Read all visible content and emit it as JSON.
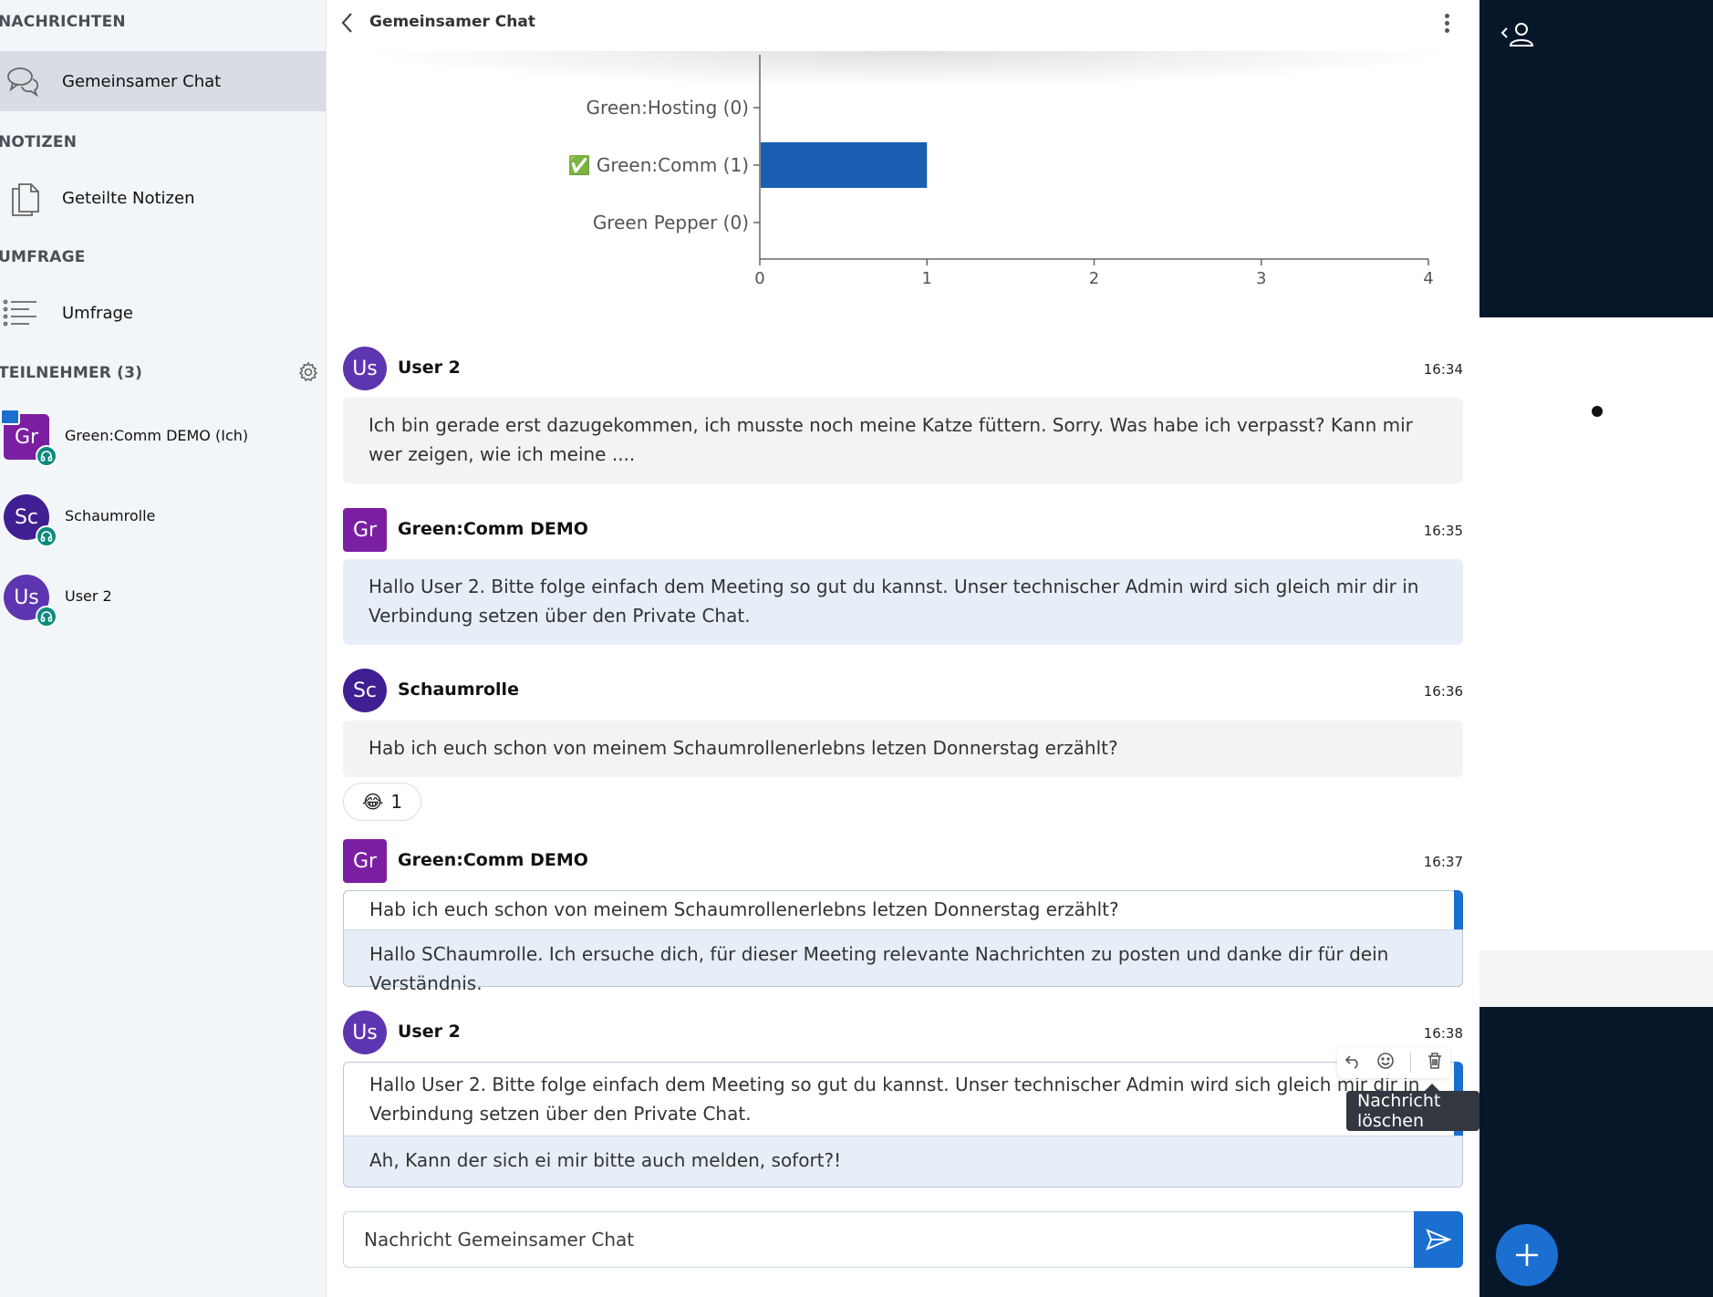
{
  "sidebar": {
    "messages_title": "NACHRICHTEN",
    "public_chat_label": "Gemeinsamer Chat",
    "notes_title": "NOTIZEN",
    "shared_notes_label": "Geteilte Notizen",
    "poll_title": "UMFRAGE",
    "poll_label": "Umfrage",
    "participants_title": "TEILNEHMER (3)",
    "users": [
      {
        "initials": "Gr",
        "name": "Green:Comm DEMO (Ich)",
        "color": "#7b1fa2"
      },
      {
        "initials": "Sc",
        "name": "Schaumrolle",
        "color": "#3f1f91"
      },
      {
        "initials": "Us",
        "name": "User 2",
        "color": "#5e35b1"
      }
    ]
  },
  "chat": {
    "title": "Gemeinsamer Chat",
    "messages": [
      {
        "initials": "Us",
        "author": "User 2",
        "time": "16:34",
        "text": "Ich bin gerade erst dazugekommen, ich musste noch meine Katze füttern. Sorry. Was habe ich verpasst? Kann mir wer zeigen, wie ich meine ...."
      },
      {
        "initials": "Gr",
        "author": "Green:Comm DEMO",
        "time": "16:35",
        "text": "Hallo User 2. Bitte folge einfach dem Meeting so gut du kannst. Unser technischer Admin wird sich gleich mir dir in Verbindung setzen über den Private Chat."
      },
      {
        "initials": "Sc",
        "author": "Schaumrolle",
        "time": "16:36",
        "text": "Hab ich euch schon von meinem Schaumrollenerlebns letzen Donnerstag erzählt?",
        "reaction": {
          "emoji": "😂",
          "count": "1"
        }
      },
      {
        "initials": "Gr",
        "author": "Green:Comm DEMO",
        "time": "16:37",
        "quote": "Hab ich euch schon von meinem Schaumrollenerlebns letzen Donnerstag erzählt?",
        "text": "Hallo SChaumrolle. Ich ersuche dich, für dieser Meeting relevante Nachrichten zu posten und danke dir für dein Verständnis."
      },
      {
        "initials": "Us",
        "author": "User 2",
        "time": "16:38",
        "quote": "Hallo User 2. Bitte folge einfach dem Meeting so gut du kannst. Unser technischer Admin wird sich gleich mir dir in Verbindung setzen über den Private Chat.",
        "text": "Ah, Kann der sich ei mir bitte auch melden, sofort?!"
      }
    ],
    "tooltip": "Nachricht löschen",
    "composer_placeholder": "Nachricht Gemeinsamer Chat"
  },
  "chart_data": {
    "type": "bar",
    "orientation": "horizontal",
    "categories": [
      "Green:Hosting (0)",
      "✅ Green:Comm (1)",
      "Green Pepper (0)"
    ],
    "values": [
      0,
      1,
      0
    ],
    "xlim": [
      0,
      4
    ],
    "xticks": [
      "0",
      "1",
      "2",
      "3",
      "4"
    ],
    "bar_color": "#1a5fb4",
    "grid": false
  },
  "colors": {
    "accent": "#1a6fd1",
    "dark_panel": "#06172a",
    "sidebar_bg": "#f3f6f9",
    "bubble_blue": "#e6eef7"
  }
}
